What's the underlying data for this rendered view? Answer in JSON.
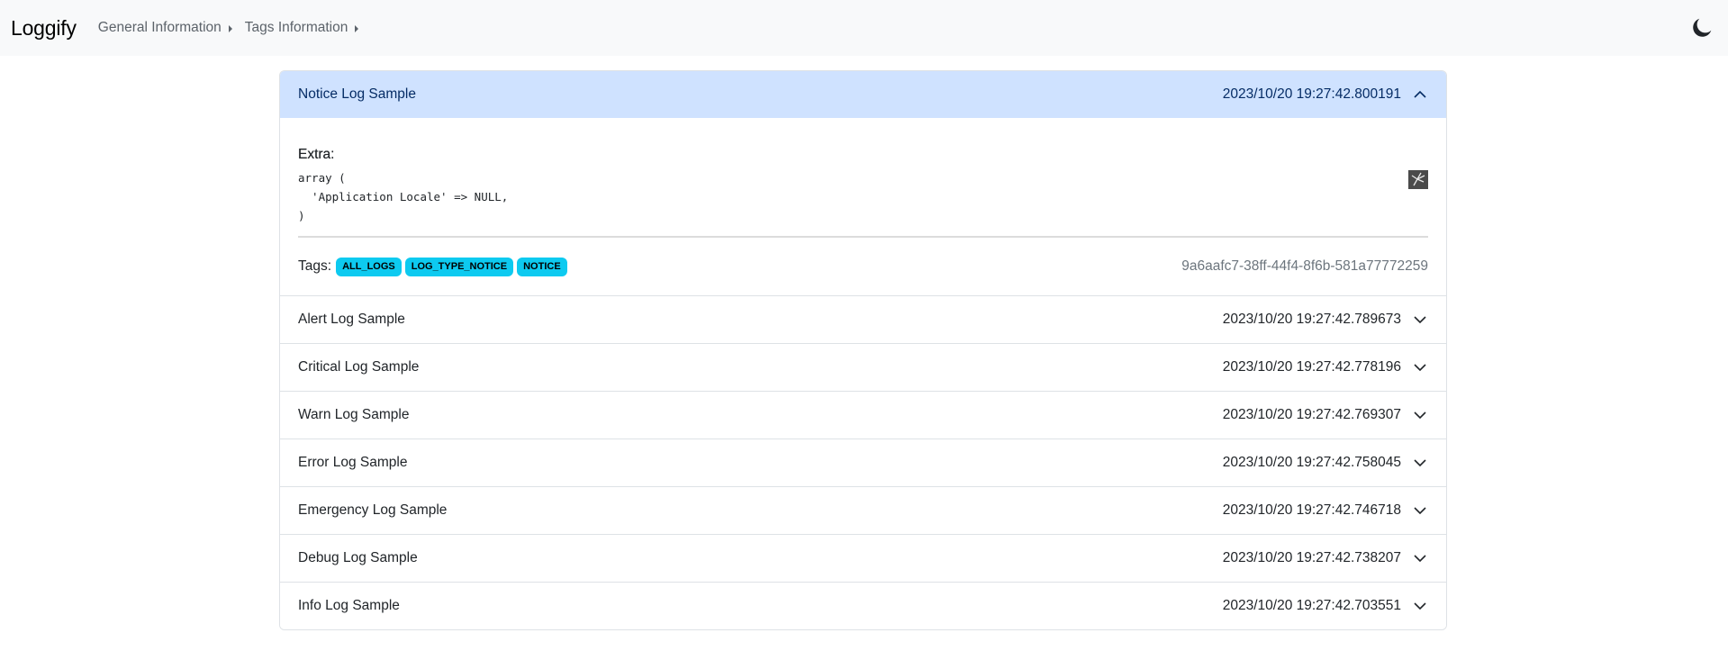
{
  "navbar": {
    "brand": "Loggify",
    "items": [
      {
        "label": "General Information"
      },
      {
        "label": "Tags Information"
      }
    ],
    "theme_toggle_icon": "moon-icon"
  },
  "logs": [
    {
      "title": "Notice Log Sample",
      "timestamp": "2023/10/20 19:27:42.800191",
      "expanded": true,
      "extra_label": "Extra:",
      "extra_code": "array (\n  'Application Locale' => NULL,\n)",
      "copy_icon": "broken-image-icon",
      "tags_label": "Tags:",
      "tags": [
        "ALL_LOGS",
        "LOG_TYPE_NOTICE",
        "NOTICE"
      ],
      "uuid": "9a6aafc7-38ff-44f4-8f6b-581a77772259"
    },
    {
      "title": "Alert Log Sample",
      "timestamp": "2023/10/20 19:27:42.789673",
      "expanded": false
    },
    {
      "title": "Critical Log Sample",
      "timestamp": "2023/10/20 19:27:42.778196",
      "expanded": false
    },
    {
      "title": "Warn Log Sample",
      "timestamp": "2023/10/20 19:27:42.769307",
      "expanded": false
    },
    {
      "title": "Error Log Sample",
      "timestamp": "2023/10/20 19:27:42.758045",
      "expanded": false
    },
    {
      "title": "Emergency Log Sample",
      "timestamp": "2023/10/20 19:27:42.746718",
      "expanded": false
    },
    {
      "title": "Debug Log Sample",
      "timestamp": "2023/10/20 19:27:42.738207",
      "expanded": false
    },
    {
      "title": "Info Log Sample",
      "timestamp": "2023/10/20 19:27:42.703551",
      "expanded": false
    }
  ],
  "colors": {
    "navbar_bg": "#f8f9fa",
    "open_header_bg": "#cfe2ff",
    "tag_bg": "#0dcaf0",
    "uuid_text": "#6c757d"
  }
}
